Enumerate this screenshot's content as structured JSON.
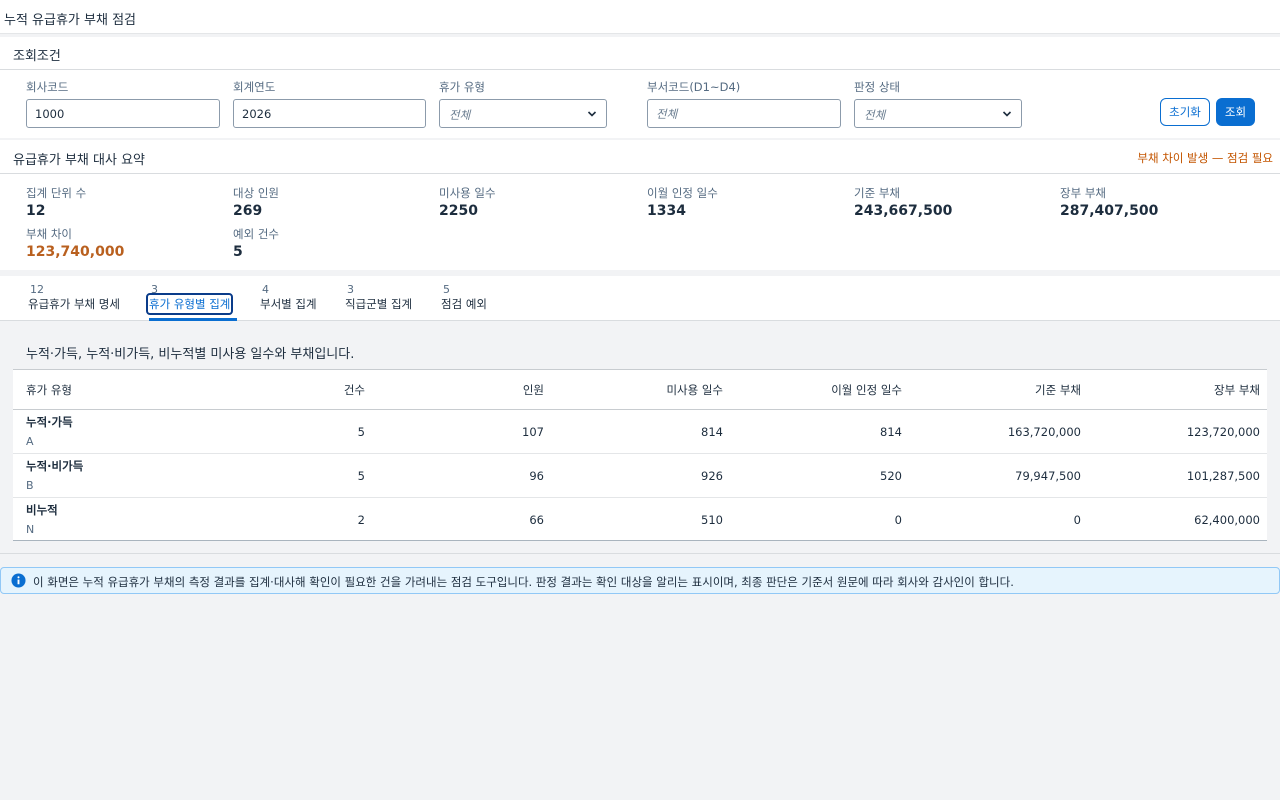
{
  "page": {
    "title": "누적 유급휴가 부채 점검"
  },
  "filters": {
    "title": "조회조건",
    "company_code": {
      "label": "회사코드",
      "value": "1000"
    },
    "fiscal_year": {
      "label": "회계연도",
      "value": "2026"
    },
    "leave_type": {
      "label": "휴가 유형",
      "selected": "전체"
    },
    "dept_code": {
      "label": "부서코드(D1~D4)",
      "placeholder": "전체"
    },
    "judgment_status": {
      "label": "판정 상태",
      "selected": "전체"
    },
    "reset_label": "초기화",
    "search_label": "조회"
  },
  "summary": {
    "title": "유급휴가 부채 대사 요약",
    "status": "부채 차이 발생 — 점검 필요",
    "status_color": "#c35500",
    "kpis": [
      {
        "label": "집계 단위 수",
        "value": "12"
      },
      {
        "label": "대상 인원",
        "value": "269"
      },
      {
        "label": "미사용 일수",
        "value": "2250"
      },
      {
        "label": "이월 인정 일수",
        "value": "1334"
      },
      {
        "label": "기준 부채",
        "value": "243,667,500"
      },
      {
        "label": "장부 부채",
        "value": "287,407,500"
      },
      {
        "label": "부채 차이",
        "value": "123,740,000"
      },
      {
        "label": "예외 건수",
        "value": "5"
      }
    ]
  },
  "tabs": [
    {
      "count": "12",
      "label": "유급휴가 부채 명세"
    },
    {
      "count": "3",
      "label": "휴가 유형별 집계"
    },
    {
      "count": "4",
      "label": "부서별 집계"
    },
    {
      "count": "3",
      "label": "직급군별 집계"
    },
    {
      "count": "5",
      "label": "점검 예외"
    }
  ],
  "active_tab": "휴가 유형별 집계",
  "table": {
    "description": "누적·가득, 누적·비가득, 비누적별 미사용 일수와 부채입니다.",
    "columns": [
      "휴가 유형",
      "건수",
      "인원",
      "미사용 일수",
      "이월 인정 일수",
      "기준 부채",
      "장부 부채"
    ],
    "rows": [
      {
        "name": "누적·가득",
        "code": "A",
        "count": "5",
        "people": "107",
        "unused_days": "814",
        "carryover_days": "814",
        "base_liability": "163,720,000",
        "book_liability": "123,720,000"
      },
      {
        "name": "누적·비가득",
        "code": "B",
        "count": "5",
        "people": "96",
        "unused_days": "926",
        "carryover_days": "520",
        "base_liability": "79,947,500",
        "book_liability": "101,287,500"
      },
      {
        "name": "비누적",
        "code": "N",
        "count": "2",
        "people": "66",
        "unused_days": "510",
        "carryover_days": "0",
        "base_liability": "0",
        "book_liability": "62,400,000"
      }
    ]
  },
  "notice": {
    "icon": "info-icon",
    "text": "이 화면은 누적 유급휴가 부채의 측정 결과를 집계·대사해 확인이 필요한 건을 가려내는 점검 도구입니다. 판정 결과는 확인 대상을 알리는 표시이며, 최종 판단은 기준서 원문에 따라 회사와 감사인이 합니다."
  },
  "colors": {
    "accent": "#0a6ed1",
    "warning": "#c35500",
    "negative_value": "#b9601f"
  }
}
